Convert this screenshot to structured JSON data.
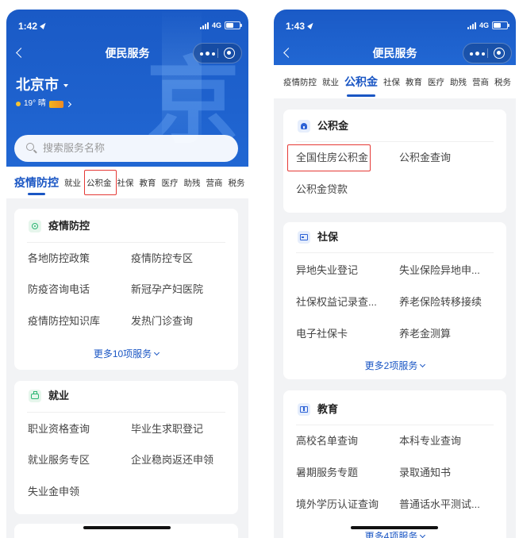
{
  "left": {
    "status_time": "1:42",
    "network": "4G",
    "battery_level": 0.55,
    "title": "便民服务",
    "city": "北京市",
    "weather": "19° 晴",
    "watermark": "京",
    "search_placeholder": "搜索服务名称",
    "tabs": [
      {
        "label": "疫情防控",
        "active": true
      },
      {
        "label": "就业"
      },
      {
        "label": "公积金",
        "highlighted": true
      },
      {
        "label": "社保"
      },
      {
        "label": "教育"
      },
      {
        "label": "医疗"
      },
      {
        "label": "助残"
      },
      {
        "label": "营商"
      },
      {
        "label": "税务"
      }
    ],
    "cards": [
      {
        "title": "疫情防控",
        "items": [
          "各地防控政策",
          "疫情防控专区",
          "防疫咨询电话",
          "新冠孕产妇医院",
          "疫情防控知识库",
          "发热门诊查询"
        ],
        "more": "更多10项服务"
      },
      {
        "title": "就业",
        "items": [
          "职业资格查询",
          "毕业生求职登记",
          "就业服务专区",
          "企业稳岗返还申领",
          "失业金申领"
        ]
      }
    ]
  },
  "right": {
    "status_time": "1:43",
    "network": "4G",
    "battery_level": 0.55,
    "title": "便民服务",
    "tabs": [
      {
        "label": "疫情防控"
      },
      {
        "label": "就业"
      },
      {
        "label": "公积金",
        "active": true
      },
      {
        "label": "社保"
      },
      {
        "label": "教育"
      },
      {
        "label": "医疗"
      },
      {
        "label": "助残"
      },
      {
        "label": "营商"
      },
      {
        "label": "税务"
      }
    ],
    "cards": [
      {
        "title": "公积金",
        "items": [
          "全国住房公积金",
          "公积金查询",
          "公积金贷款"
        ],
        "highlighted_item_index": 0
      },
      {
        "title": "社保",
        "items": [
          "异地失业登记",
          "失业保险异地申...",
          "社保权益记录查...",
          "养老保险转移接续",
          "电子社保卡",
          "养老金测算"
        ],
        "more": "更多2项服务"
      },
      {
        "title": "教育",
        "items": [
          "高校名单查询",
          "本科专业查询",
          "暑期服务专题",
          "录取通知书",
          "境外学历认证查询",
          "普通话水平测试..."
        ],
        "more": "更多4项服务"
      }
    ]
  },
  "colors": {
    "brand_blue": "#1d5fcf",
    "active_tab": "#1a56c4",
    "highlight_box": "#e53935",
    "page_bg": "#f2f3f5",
    "epidemic_icon": "#2bb673"
  },
  "icons": {
    "back": "back-arrow-icon",
    "more": "more-dots-icon",
    "close": "capsule-close-icon",
    "search": "search-icon",
    "location": "location-arrow-icon",
    "epidemic": "shield-ring-icon",
    "employment": "briefcase-icon",
    "housing_fund": "house-icon",
    "social_security": "card-icon",
    "education": "book-icon"
  }
}
